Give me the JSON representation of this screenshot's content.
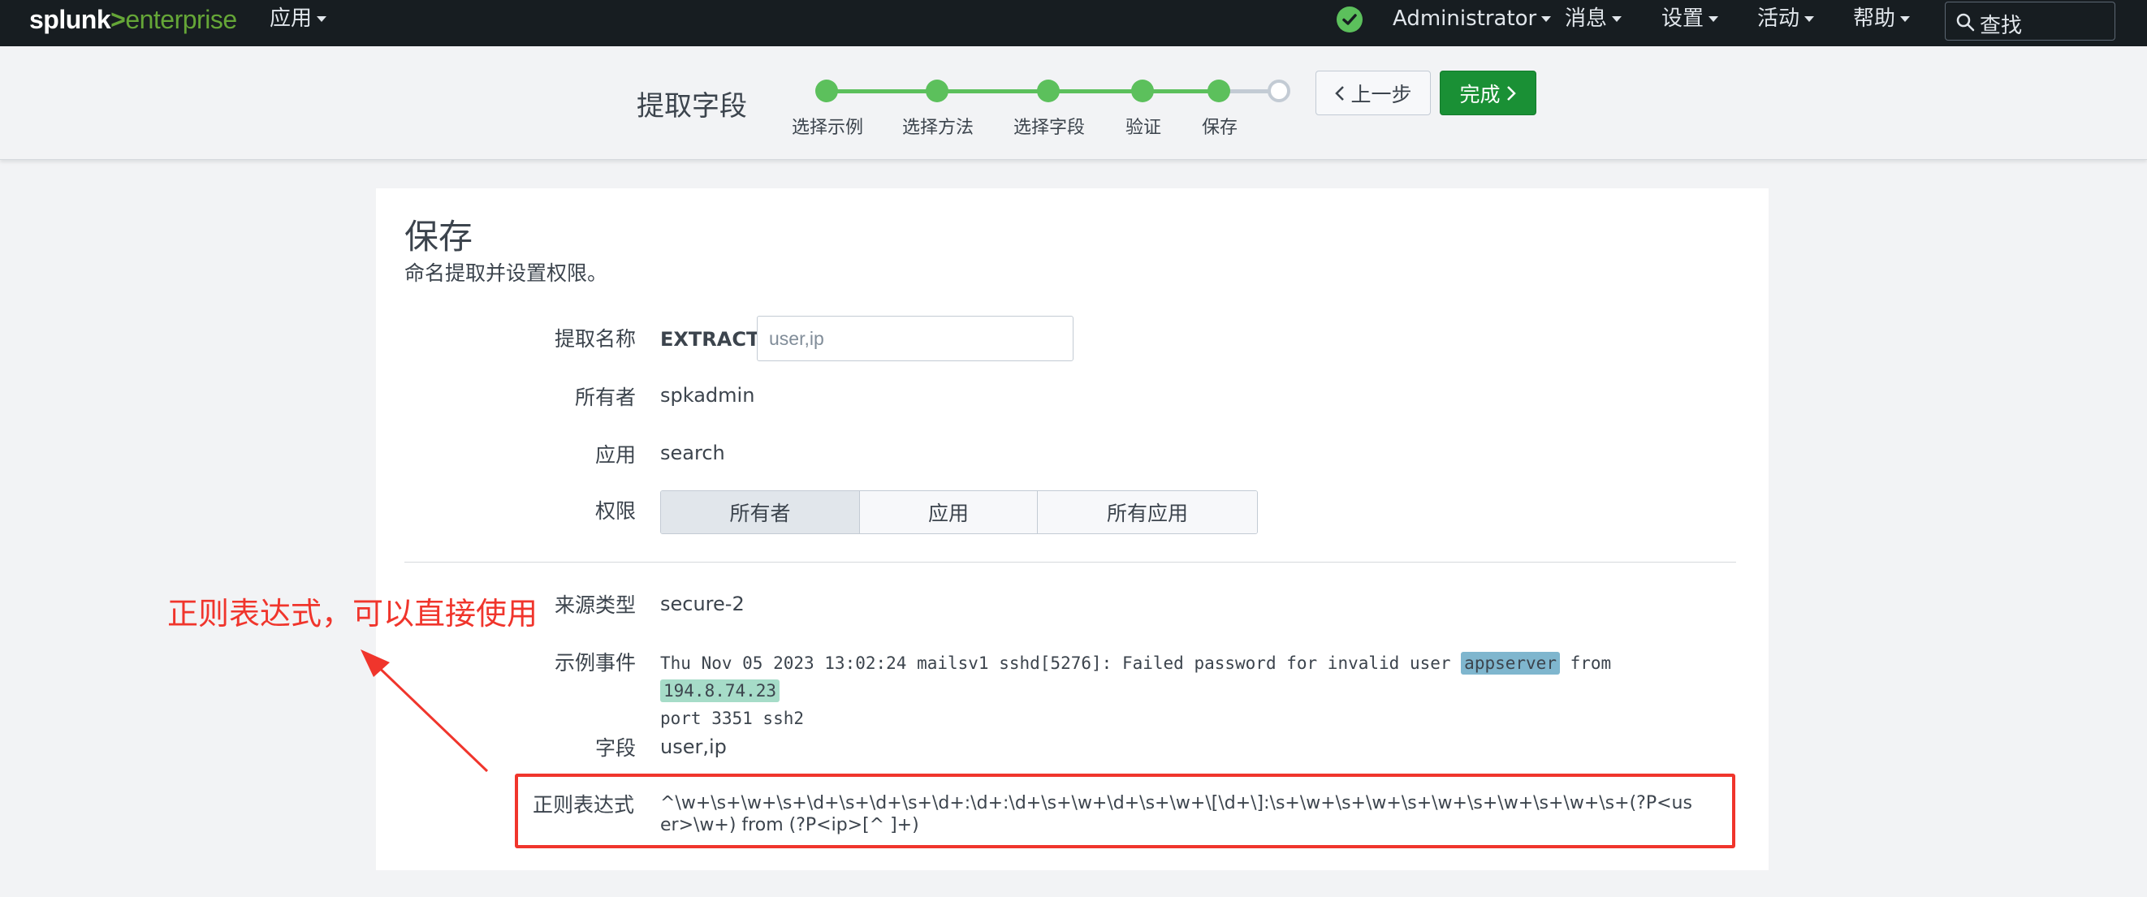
{
  "topbar": {
    "logo_left": "splunk",
    "logo_sep": ">",
    "logo_right": "enterprise",
    "apps_menu": "应用",
    "user_menu": "Administrator",
    "messages_menu": "消息",
    "settings_menu": "设置",
    "activity_menu": "活动",
    "help_menu": "帮助",
    "search_label": "查找"
  },
  "wizard": {
    "title": "提取字段",
    "steps": [
      {
        "label": "选择示例",
        "status": "done"
      },
      {
        "label": "选择方法",
        "status": "done"
      },
      {
        "label": "选择字段",
        "status": "done"
      },
      {
        "label": "验证",
        "status": "done"
      },
      {
        "label": "保存",
        "status": "current"
      },
      {
        "label": "",
        "status": "pending"
      }
    ],
    "prev_label": "上一步",
    "done_label": "完成"
  },
  "panel": {
    "title": "保存",
    "subtitle": "命名提取并设置权限。",
    "extraction_name_label": "提取名称",
    "extraction_prefix": "EXTRACT-",
    "extraction_placeholder": "user,ip",
    "owner_label": "所有者",
    "owner_value": "spkadmin",
    "app_label": "应用",
    "app_value": "search",
    "permissions_label": "权限",
    "permissions_options": [
      "所有者",
      "应用",
      "所有应用"
    ],
    "permissions_selected": "所有者",
    "sourcetype_label": "来源类型",
    "sourcetype_value": "secure-2",
    "sample_label": "示例事件",
    "sample_part1": "Thu Nov 05 2023 13:02:24 mailsv1 sshd[5276]: Failed password for invalid user ",
    "sample_user": "appserver",
    "sample_part2": " from ",
    "sample_ip": "194.8.74.23",
    "sample_part3": "port 3351 ssh2",
    "fields_label": "字段",
    "fields_value": "user,ip",
    "regex_label": "正则表达式",
    "regex_value": "^\\w+\\s+\\w+\\s+\\d+\\s+\\d+\\s+\\d+:\\d+:\\d+\\s+\\w+\\d+\\s+\\w+\\[\\d+\\]:\\s+\\w+\\s+\\w+\\s+\\w+\\s+\\w+\\s+\\w+\\s+(?P<user>\\w+) from (?P<ip>[^ ]+)"
  },
  "annotation": {
    "text": "正则表达式，可以直接使用"
  },
  "colors": {
    "topbar_bg": "#171d21",
    "brand_green": "#65a637",
    "step_green": "#5cc05c",
    "done_button": "#1a9035",
    "annotation_red": "#f0352c",
    "highlight_user": "#7fb6ce",
    "highlight_ip": "#a6dcc8"
  }
}
